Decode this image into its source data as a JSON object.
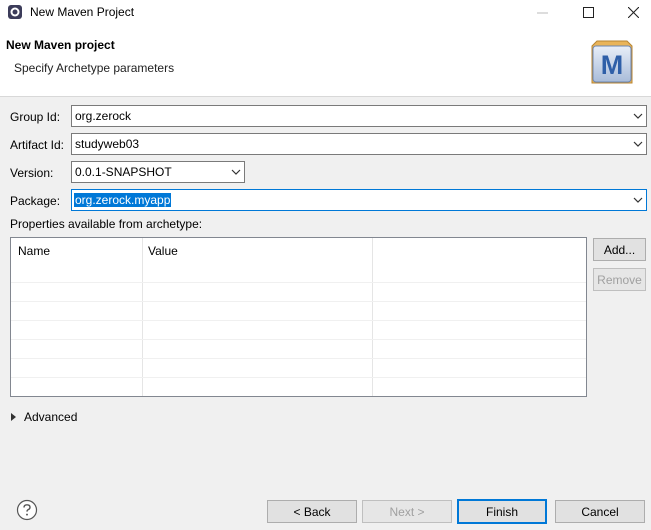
{
  "window": {
    "title": "New Maven Project"
  },
  "header": {
    "title": "New Maven project",
    "subtitle": "Specify Archetype parameters",
    "logo_letter": "M"
  },
  "form": {
    "group_id": {
      "label": "Group Id:",
      "value": "org.zerock"
    },
    "artifact_id": {
      "label": "Artifact Id:",
      "value": "studyweb03"
    },
    "version": {
      "label": "Version:",
      "value": "0.0.1-SNAPSHOT"
    },
    "package": {
      "label": "Package:",
      "value": "org.zerock.myapp"
    }
  },
  "properties": {
    "label": "Properties available from archetype:",
    "columns": [
      "Name",
      "Value"
    ],
    "rows": [],
    "add_label": "Add...",
    "remove_label": "Remove"
  },
  "advanced": {
    "label": "Advanced"
  },
  "buttons": {
    "back": "< Back",
    "next": "Next >",
    "finish": "Finish",
    "cancel": "Cancel"
  },
  "colors": {
    "accent": "#0078d7",
    "dialog_bg": "#f0f0f0",
    "logo_blue": "#3b6fb6"
  },
  "icons": {
    "app": "eclipse-icon",
    "help": "help-icon",
    "dropdown": "chevron-down-icon",
    "advanced": "triangle-right-icon"
  }
}
